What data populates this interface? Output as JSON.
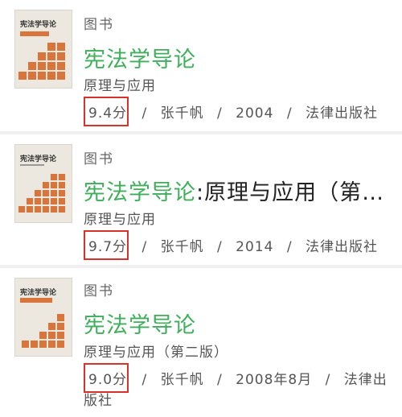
{
  "books": [
    {
      "category": "图书",
      "title": "宪法学导论",
      "title_rest": "",
      "subtitle": "原理与应用",
      "rating": "9.4分",
      "author": "张千帆",
      "year": "2004",
      "publisher": "法律出版社",
      "cover_title": "宪法学导论"
    },
    {
      "category": "图书",
      "title": "宪法学导论",
      "title_rest": ":原理与应用（第…",
      "subtitle": "原理与应用",
      "rating": "9.7分",
      "author": "张千帆",
      "year": "2014",
      "publisher": "法律出版社",
      "cover_title": "宪法学导论"
    },
    {
      "category": "图书",
      "title": "宪法学导论",
      "title_rest": "",
      "subtitle": "原理与应用（第二版）",
      "rating": "9.0分",
      "author": "张千帆",
      "year": "2008年8月",
      "publisher_line1": "法律出",
      "publisher_line2": "版社",
      "cover_title": "宪法学导论"
    }
  ],
  "separator": "/",
  "colors": {
    "title_green": "#3fae5b",
    "rating_box": "#d9322b",
    "stairs": "#d9743a"
  }
}
